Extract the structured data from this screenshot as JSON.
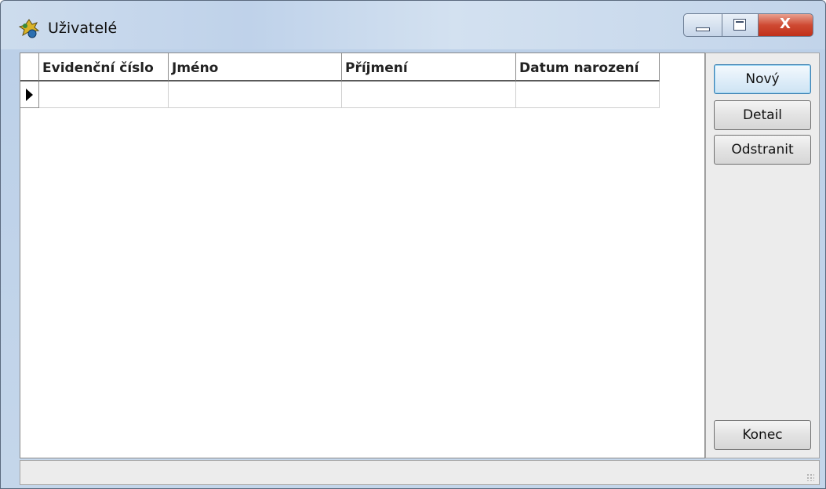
{
  "window": {
    "title": "Uživatelé",
    "close_glyph": "X",
    "icons": {
      "app": "app-icon",
      "minimize": "minimize-icon",
      "maximize": "maximize-icon",
      "close": "close-icon"
    }
  },
  "grid": {
    "columns": [
      "Evidenční číslo",
      "Jméno",
      "Příjmení",
      "Datum narození"
    ],
    "rows": [
      {
        "current": true,
        "cells": [
          "",
          "",
          "",
          ""
        ]
      }
    ]
  },
  "buttons": {
    "new": "Nový",
    "detail": "Detail",
    "remove": "Odstranit",
    "close": "Konec"
  },
  "status": ""
}
